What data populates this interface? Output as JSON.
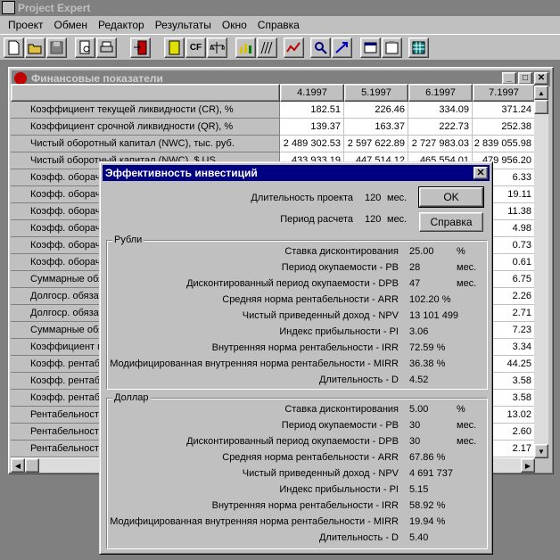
{
  "app": {
    "title": "Project Expert"
  },
  "menu": [
    "Проект",
    "Обмен",
    "Редактор",
    "Результаты",
    "Окно",
    "Справка"
  ],
  "toolbar": {
    "cf_label": "CF"
  },
  "child": {
    "title": "Финансовые показатели",
    "minimize": "_",
    "restore": "□",
    "close": "✕"
  },
  "table": {
    "columns": [
      "4.1997",
      "5.1997",
      "6.1997",
      "7.1997"
    ],
    "rows": [
      {
        "label": "Коэффициент текущей ликвидности (CR), %",
        "values": [
          "182.51",
          "226.46",
          "334.09",
          "371.24"
        ]
      },
      {
        "label": "Коэффициент срочной ликвидности (QR), %",
        "values": [
          "139.37",
          "163.37",
          "222.73",
          "252.38"
        ]
      },
      {
        "label": "Чистый оборотный капитал (NWC), тыс. руб.",
        "values": [
          "2 489 302.53",
          "2 597 622.89",
          "2 727 983.03",
          "2 839 055.98"
        ]
      },
      {
        "label": "Чистый оборотный капитал (NWC), $ US",
        "values": [
          "433 933.19",
          "447 514.12",
          "465 554.01",
          "479 956.20"
        ]
      },
      {
        "label": "Коэфф. оборачиваемости",
        "values": [
          "",
          "",
          "",
          "6.33"
        ]
      },
      {
        "label": "Коэфф. оборачиваемости",
        "values": [
          "",
          "",
          "",
          "19.11"
        ]
      },
      {
        "label": "Коэфф. оборачиваемости",
        "values": [
          "",
          "",
          "",
          "11.38"
        ]
      },
      {
        "label": "Коэфф. оборачиваемости",
        "values": [
          "",
          "",
          "",
          "4.98"
        ]
      },
      {
        "label": "Коэфф. оборачиваемости",
        "values": [
          "",
          "",
          "",
          "0.73"
        ]
      },
      {
        "label": "Коэфф. оборачиваемости",
        "values": [
          "",
          "",
          "",
          "0.61"
        ]
      },
      {
        "label": "Суммарные обязательства",
        "values": [
          "",
          "",
          "",
          "6.75"
        ]
      },
      {
        "label": "Долгоср. обязательства",
        "values": [
          "",
          "",
          "",
          "2.26"
        ]
      },
      {
        "label": "Долгоср. обязательства",
        "values": [
          "",
          "",
          "",
          "2.71"
        ]
      },
      {
        "label": "Суммарные обязательства",
        "values": [
          "",
          "",
          "",
          "7.23"
        ]
      },
      {
        "label": "Коэффициент покрытия",
        "values": [
          "",
          "",
          "",
          "3.34"
        ]
      },
      {
        "label": "Коэфф. рентабельности",
        "values": [
          "",
          "",
          "",
          "44.25"
        ]
      },
      {
        "label": "Коэфф. рентабельности",
        "values": [
          "",
          "",
          "",
          "3.58"
        ]
      },
      {
        "label": "Коэфф. рентабельности",
        "values": [
          "",
          "",
          "",
          "3.58"
        ]
      },
      {
        "label": "Рентабельность",
        "values": [
          "",
          "",
          "",
          "13.02"
        ]
      },
      {
        "label": "Рентабельность",
        "values": [
          "",
          "",
          "",
          "2.60"
        ]
      },
      {
        "label": "Рентабельность",
        "values": [
          "",
          "",
          "",
          "2.17"
        ]
      }
    ]
  },
  "dialog": {
    "title": "Эффективность инвестиций",
    "close": "✕",
    "duration_label": "Длительность проекта",
    "duration_value": "120",
    "duration_unit": "мес.",
    "period_label": "Период расчета",
    "period_value": "120",
    "period_unit": "мес.",
    "ok": "OK",
    "help": "Справка",
    "rub": {
      "title": "Рубли",
      "rows": [
        {
          "label": "Ставка дисконтирования",
          "value": "25.00",
          "unit": "%"
        },
        {
          "label": "Период окупаемости - PB",
          "value": "28",
          "unit": "мес."
        },
        {
          "label": "Дисконтированный период окупаемости - DPB",
          "value": "47",
          "unit": "мес."
        },
        {
          "label": "Средняя норма рентабельности - ARR",
          "value": "102.20 %",
          "unit": ""
        },
        {
          "label": "Чистый приведенный доход - NPV",
          "value": "13 101 499",
          "unit": ""
        },
        {
          "label": "Индекс прибыльности - PI",
          "value": "3.06",
          "unit": ""
        },
        {
          "label": "Внутренняя норма рентабельности - IRR",
          "value": "72.59 %",
          "unit": ""
        },
        {
          "label": "Модифицированная внутренняя норма рентабельности - MIRR",
          "value": "36.38 %",
          "unit": ""
        },
        {
          "label": "Длительность - D",
          "value": "4.52",
          "unit": ""
        }
      ]
    },
    "usd": {
      "title": "Доллар",
      "rows": [
        {
          "label": "Ставка дисконтирования",
          "value": "5.00",
          "unit": "%"
        },
        {
          "label": "Период окупаемости - PB",
          "value": "30",
          "unit": "мес."
        },
        {
          "label": "Дисконтированный период окупаемости - DPB",
          "value": "30",
          "unit": "мес."
        },
        {
          "label": "Средняя норма рентабельности - ARR",
          "value": "67.86 %",
          "unit": ""
        },
        {
          "label": "Чистый приведенный доход - NPV",
          "value": "4 691 737",
          "unit": ""
        },
        {
          "label": "Индекс прибыльности - PI",
          "value": "5.15",
          "unit": ""
        },
        {
          "label": "Внутренняя норма рентабельности - IRR",
          "value": "58.92 %",
          "unit": ""
        },
        {
          "label": "Модифицированная внутренняя норма рентабельности - MIRR",
          "value": "19.94 %",
          "unit": ""
        },
        {
          "label": "Длительность - D",
          "value": "5.40",
          "unit": ""
        }
      ]
    }
  }
}
